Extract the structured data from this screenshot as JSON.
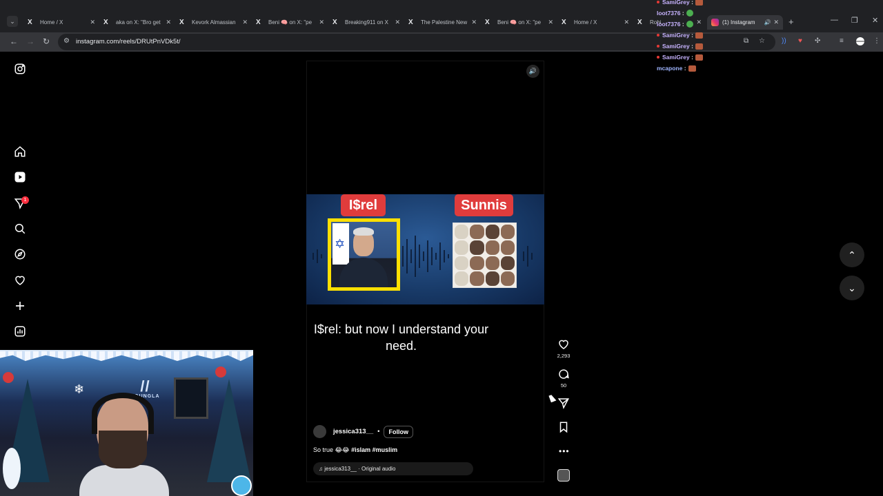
{
  "browser": {
    "tabs": [
      {
        "favicon": "X",
        "title": "Home / X"
      },
      {
        "favicon": "X",
        "title": "aka on X: \"Bro get"
      },
      {
        "favicon": "X",
        "title": "Kevork Almassian"
      },
      {
        "favicon": "X",
        "title": "Beni 🧠 on X: \"pe"
      },
      {
        "favicon": "X",
        "title": "Breaking911 on X"
      },
      {
        "favicon": "X",
        "title": "The Palestine New"
      },
      {
        "favicon": "X",
        "title": "Beni 🧠 on X: \"pe"
      },
      {
        "favicon": "X",
        "title": "Home / X"
      },
      {
        "favicon": "X",
        "title": "Rohi"
      }
    ],
    "active_tab": {
      "title": "(1) Instagram"
    },
    "url": "instagram.com/reels/DRUtPnVDk5t/"
  },
  "chat": [
    {
      "user": "SamiGrey",
      "emote": "brown"
    },
    {
      "user": "loot7376",
      "emote": "green"
    },
    {
      "user": "loot7376",
      "emote": "green"
    },
    {
      "user": "SamiGrey",
      "emote": "brown"
    },
    {
      "user": "SamiGrey",
      "emote": "brown"
    },
    {
      "user": "SamiGrey",
      "emote": "brown"
    },
    {
      "user": "mcapone",
      "emote": "brown"
    }
  ],
  "sidebar": {
    "icons": [
      "instagram-logo-icon",
      "home-icon",
      "reels-icon",
      "messages-icon",
      "search-icon",
      "explore-icon",
      "notifications-icon",
      "create-icon",
      "dashboard-icon"
    ],
    "notification_badge": "1"
  },
  "reel": {
    "left_tag": "I$rel",
    "right_tag": "Sunnis",
    "subtitle": "I$rel: but now I understand your need.",
    "author": "jessica313__",
    "separator": "•",
    "follow_label": "Follow",
    "caption_text": "So true 😂😂 ",
    "caption_tags": "#islam #muslim",
    "audio_label": "jessica313__ · Original audio",
    "likes": "2,293",
    "comments": "50"
  },
  "colors": {
    "tag_red": "#e03c3c",
    "frame_yellow": "#ffe000",
    "badge_red": "#ff3040"
  }
}
